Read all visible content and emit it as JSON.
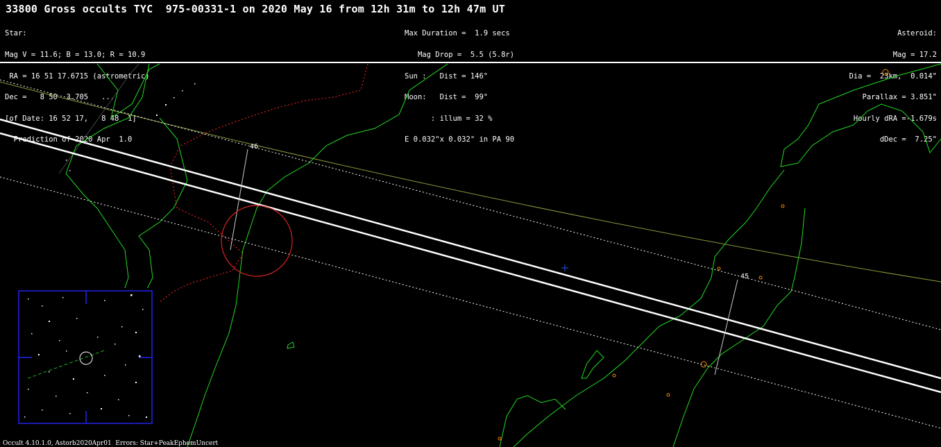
{
  "title": "33800 Gross occults TYC  975-00331-1 on 2020 May 16 from 12h 31m to 12h 47m UT",
  "star": {
    "lines": [
      "Star:",
      "Mag V = 11.6; B = 13.0; R = 10.9",
      " RA = 16 51 17.6715 (astrometric)",
      "Dec =   8 50  3.705   ...",
      "[of Date: 16 52 17,   8 48  1]",
      "  Prediction of 2020 Apr  1.0"
    ]
  },
  "event": {
    "lines": [
      "Max Duration =  1.9 secs",
      "   Mag Drop =  5.5 (5.8r)",
      "Sun :   Dist = 146°",
      "Moon:   Dist =  99°",
      "      : illum = 32 %",
      "E 0.032\"x 0.032\" in PA 90"
    ]
  },
  "asteroid": {
    "lines": [
      "Asteroid:",
      "Mag = 17.2",
      "Dia =  23km,  0.014\"",
      "Parallax = 3.851\"",
      "Hourly dRA =-1.679s",
      "dDec =  7.25\""
    ]
  },
  "map": {
    "time_labels": [
      "46",
      "45"
    ],
    "colors": {
      "coastline": "#22dd22",
      "border": "#dd2222",
      "path": "#ffffff",
      "ecliptic": "#8a9a3a",
      "finder_frame": "#2222ee",
      "city": "#ff8c00"
    }
  },
  "footer": "Occult 4.10.1.0, Astorb2020Apr01  Errors: Star+PeakEphemUncert"
}
